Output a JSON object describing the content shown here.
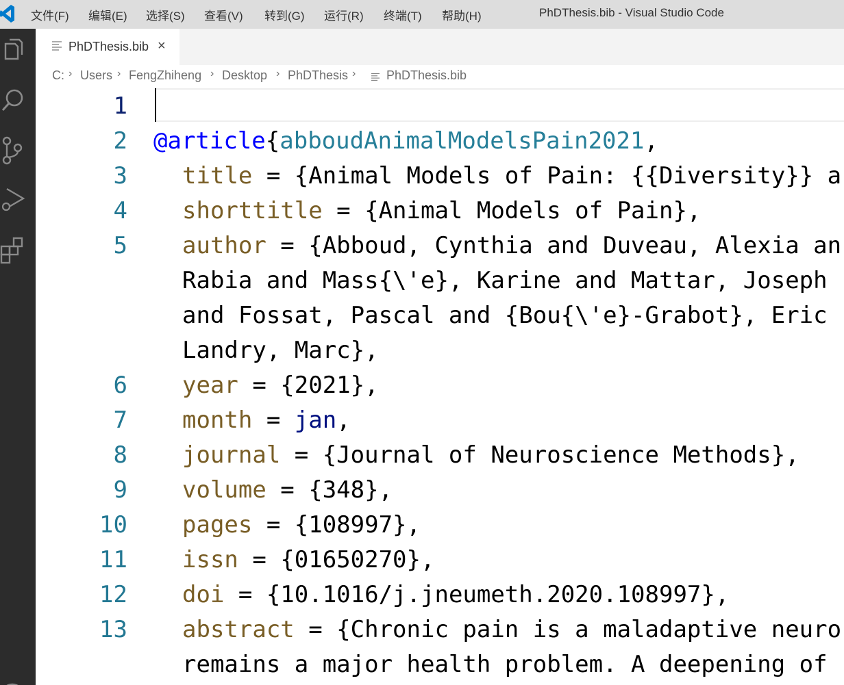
{
  "window": {
    "title": "PhDThesis.bib - Visual Studio Code",
    "menu": [
      "文件(F)",
      "编辑(E)",
      "选择(S)",
      "查看(V)",
      "转到(G)",
      "运行(R)",
      "终端(T)",
      "帮助(H)"
    ]
  },
  "activity_bar": {
    "icons": [
      "explorer-icon",
      "search-icon",
      "source-control-icon",
      "run-debug-icon",
      "extensions-icon",
      "account-icon"
    ]
  },
  "tab": {
    "label": "PhDThesis.bib",
    "close": "×"
  },
  "breadcrumb": {
    "items": [
      "C:",
      "Users",
      "FengZhiheng",
      "Desktop",
      "PhDThesis",
      "PhDThesis.bib"
    ]
  },
  "editor": {
    "lines": [
      {
        "n": "1",
        "text": ""
      },
      {
        "n": "2",
        "at": "@article",
        "brace": "{",
        "key": "abboudAnimalModelsPain2021",
        "comma": ","
      },
      {
        "n": "3",
        "field": "title",
        "rest": " = {Animal Models of Pain: {{Diversity}} a"
      },
      {
        "n": "4",
        "field": "shorttitle",
        "rest": " = {Animal Models of Pain},"
      },
      {
        "n": "5",
        "field": "author",
        "rest": " = {Abboud, Cynthia and Duveau, Alexia an"
      },
      {
        "n": "",
        "text": "Rabia and Mass{\\'e}, Karine and Mattar, Joseph"
      },
      {
        "n": "",
        "text": "and Fossat, Pascal and {Bou{\\'e}-Grabot}, Eric"
      },
      {
        "n": "",
        "text": "Landry, Marc},"
      },
      {
        "n": "6",
        "field": "year",
        "rest": " = {2021},"
      },
      {
        "n": "7",
        "field": "month",
        "eq": " = ",
        "var": "jan",
        "end": ","
      },
      {
        "n": "8",
        "field": "journal",
        "rest": " = {Journal of Neuroscience Methods},"
      },
      {
        "n": "9",
        "field": "volume",
        "rest": " = {348},"
      },
      {
        "n": "10",
        "field": "pages",
        "rest": " = {108997},"
      },
      {
        "n": "11",
        "field": "issn",
        "rest": " = {01650270},"
      },
      {
        "n": "12",
        "field": "doi",
        "rest": " = {10.1016/j.jneumeth.2020.108997},"
      },
      {
        "n": "13",
        "field": "abstract",
        "rest": " = {Chronic pain is a maladaptive neuro"
      },
      {
        "n": "",
        "text": "remains a major health problem. A deepening of"
      }
    ]
  },
  "colors": {
    "keyword": "#0000ff",
    "citation_key": "#267f99",
    "field_name": "#795e26",
    "line_number": "#237893",
    "active_line_number": "#0b216f",
    "activity_bar_bg": "#2c2c2c",
    "title_bar_bg": "#dddddd",
    "vscode_blue": "#007acc"
  }
}
